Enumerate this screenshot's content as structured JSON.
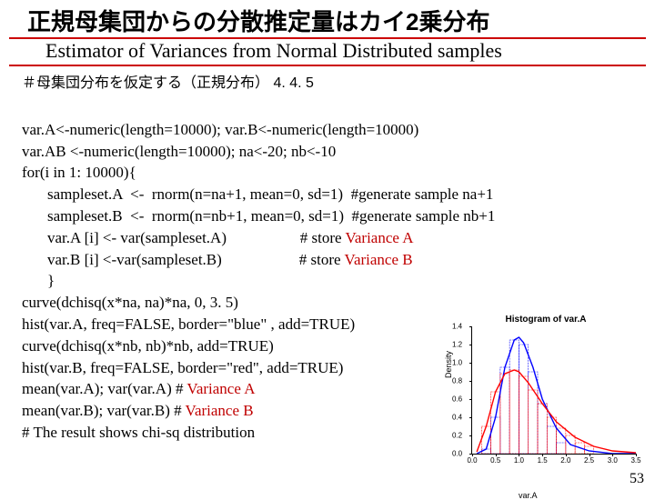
{
  "title_jp": "正規母集団からの分散推定量はカイ2乗分布",
  "title_en": "Estimator of Variances from Normal Distributed samples",
  "comment_header": "＃母集団分布を仮定する（正規分布） 4. 4. 5",
  "code": {
    "l1": "var.A<-numeric(length=10000); var.B<-numeric(length=10000)",
    "l2": "var.AB <-numeric(length=10000); na<-20; nb<-10",
    "l3": "for(i in 1: 10000){",
    "l4": "sampleset.A  <-  rnorm(n=na+1, mean=0, sd=1)  #generate sample na+1",
    "l5": "sampleset.B  <-  rnorm(n=nb+1, mean=0, sd=1)  #generate sample nb+1",
    "l6a": "var.A [i] <- var(sampleset.A)                   # store ",
    "l6b": "Variance A",
    "l7a": "var.B [i] <-var(sampleset.B)                    # store ",
    "l7b": "Variance B",
    "l8": "}",
    "l9": "curve(dchisq(x*na, na)*na, 0, 3. 5)",
    "l10": "hist(var.A, freq=FALSE, border=\"blue\" , add=TRUE)",
    "l11": "curve(dchisq(x*nb, nb)*nb, add=TRUE)",
    "l12": "hist(var.B, freq=FALSE, border=\"red\", add=TRUE)",
    "l13a": "mean(var.A); var(var.A) # ",
    "l13b": "Variance A",
    "l14a": "mean(var.B); var(var.B) # ",
    "l14b": "Variance B",
    "l15": "# The result shows chi-sq distribution"
  },
  "page_number": "53",
  "chart_data": {
    "type": "line",
    "title": "Histogram of var.A",
    "xlabel": "var.A",
    "ylabel": "Density",
    "xlim": [
      0.0,
      3.5
    ],
    "ylim": [
      0.0,
      1.4
    ],
    "xticks": [
      "0.0",
      "0.5",
      "1.0",
      "1.5",
      "2.0",
      "2.5",
      "3.0",
      "3.5"
    ],
    "yticks": [
      "0.0",
      "0.2",
      "0.4",
      "0.6",
      "0.8",
      "1.0",
      "1.2",
      "1.4"
    ],
    "series": [
      {
        "name": "dchisq na=20 (blue curve)",
        "color": "#0000ff",
        "x": [
          0.1,
          0.3,
          0.5,
          0.7,
          0.9,
          1.0,
          1.1,
          1.3,
          1.5,
          1.8,
          2.1,
          2.5,
          3.0,
          3.5
        ],
        "y": [
          0.0,
          0.05,
          0.4,
          0.95,
          1.25,
          1.28,
          1.22,
          0.95,
          0.6,
          0.28,
          0.1,
          0.03,
          0.0,
          0.0
        ]
      },
      {
        "name": "dchisq nb=10 (red curve)",
        "color": "#ff0000",
        "x": [
          0.1,
          0.3,
          0.5,
          0.7,
          0.9,
          1.0,
          1.2,
          1.5,
          1.8,
          2.2,
          2.6,
          3.0,
          3.5
        ],
        "y": [
          0.02,
          0.3,
          0.68,
          0.88,
          0.92,
          0.9,
          0.78,
          0.55,
          0.35,
          0.18,
          0.08,
          0.03,
          0.01
        ]
      }
    ],
    "histograms": [
      {
        "name": "var.A hist",
        "border": "#0000ff"
      },
      {
        "name": "var.B hist",
        "border": "#ff0000"
      }
    ]
  }
}
